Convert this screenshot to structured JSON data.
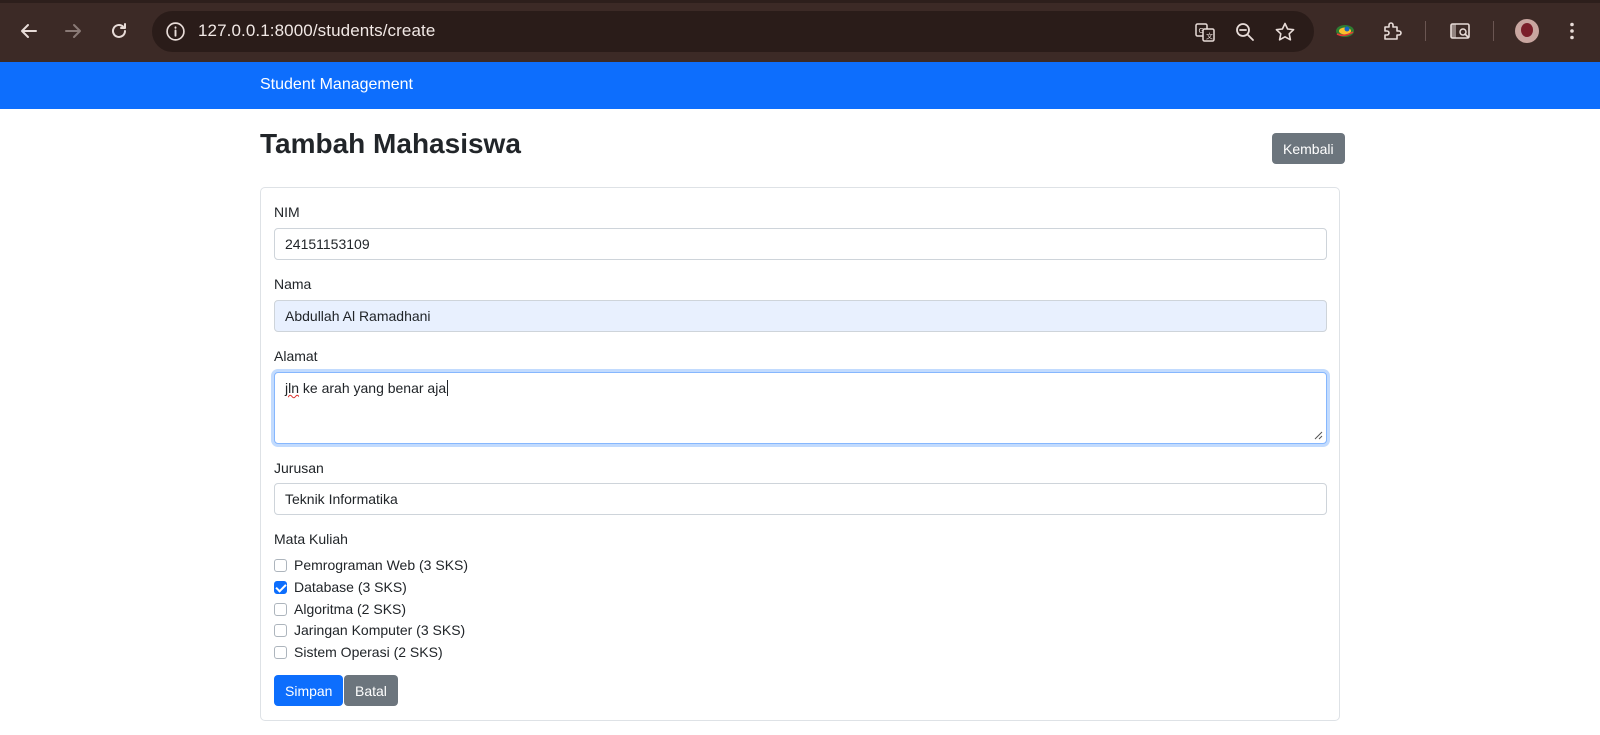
{
  "browser": {
    "url": "127.0.0.1:8000/students/create"
  },
  "navbar": {
    "brand": "Student Management"
  },
  "page": {
    "title": "Tambah Mahasiswa",
    "back_label": "Kembali"
  },
  "form": {
    "nim": {
      "label": "NIM",
      "value": "24151153109"
    },
    "nama": {
      "label": "Nama",
      "value": "Abdullah Al Ramadhani"
    },
    "alamat": {
      "label": "Alamat",
      "value_word1": "jln",
      "value_rest": " ke arah yang benar aja"
    },
    "jurusan": {
      "label": "Jurusan",
      "value": "Teknik Informatika"
    },
    "mata_kuliah": {
      "label": "Mata Kuliah",
      "options": [
        {
          "label": "Pemrograman Web (3 SKS)",
          "checked": false
        },
        {
          "label": "Database (3 SKS)",
          "checked": true
        },
        {
          "label": "Algoritma (2 SKS)",
          "checked": false
        },
        {
          "label": "Jaringan Komputer (3 SKS)",
          "checked": false
        },
        {
          "label": "Sistem Operasi (2 SKS)",
          "checked": false
        }
      ]
    },
    "save_label": "Simpan",
    "cancel_label": "Batal"
  },
  "colors": {
    "primary": "#0d6efd",
    "secondary": "#6c757d",
    "chrome": "#3c2a26"
  },
  "icons": [
    "back-arrow-icon",
    "forward-arrow-icon",
    "reload-icon",
    "info-icon",
    "translate-icon",
    "zoom-out-icon",
    "star-icon",
    "extension-colorful-icon",
    "puzzle-icon",
    "cast-search-icon",
    "avatar",
    "kebab-menu-icon"
  ]
}
